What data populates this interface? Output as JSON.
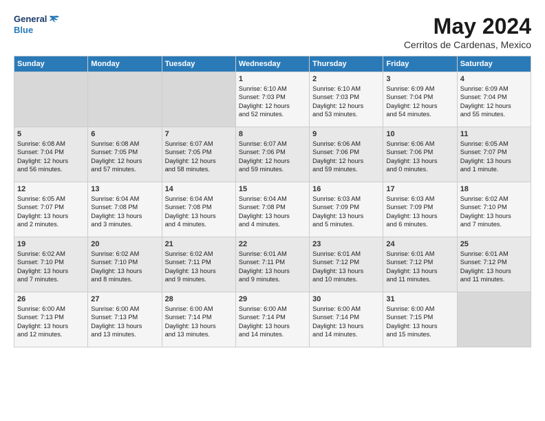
{
  "header": {
    "logo_line1": "General",
    "logo_line2": "Blue",
    "month_title": "May 2024",
    "location": "Cerritos de Cardenas, Mexico"
  },
  "days_of_week": [
    "Sunday",
    "Monday",
    "Tuesday",
    "Wednesday",
    "Thursday",
    "Friday",
    "Saturday"
  ],
  "weeks": [
    [
      {
        "day": "",
        "content": ""
      },
      {
        "day": "",
        "content": ""
      },
      {
        "day": "",
        "content": ""
      },
      {
        "day": "1",
        "content": "Sunrise: 6:10 AM\nSunset: 7:03 PM\nDaylight: 12 hours\nand 52 minutes."
      },
      {
        "day": "2",
        "content": "Sunrise: 6:10 AM\nSunset: 7:03 PM\nDaylight: 12 hours\nand 53 minutes."
      },
      {
        "day": "3",
        "content": "Sunrise: 6:09 AM\nSunset: 7:04 PM\nDaylight: 12 hours\nand 54 minutes."
      },
      {
        "day": "4",
        "content": "Sunrise: 6:09 AM\nSunset: 7:04 PM\nDaylight: 12 hours\nand 55 minutes."
      }
    ],
    [
      {
        "day": "5",
        "content": "Sunrise: 6:08 AM\nSunset: 7:04 PM\nDaylight: 12 hours\nand 56 minutes."
      },
      {
        "day": "6",
        "content": "Sunrise: 6:08 AM\nSunset: 7:05 PM\nDaylight: 12 hours\nand 57 minutes."
      },
      {
        "day": "7",
        "content": "Sunrise: 6:07 AM\nSunset: 7:05 PM\nDaylight: 12 hours\nand 58 minutes."
      },
      {
        "day": "8",
        "content": "Sunrise: 6:07 AM\nSunset: 7:06 PM\nDaylight: 12 hours\nand 59 minutes."
      },
      {
        "day": "9",
        "content": "Sunrise: 6:06 AM\nSunset: 7:06 PM\nDaylight: 12 hours\nand 59 minutes."
      },
      {
        "day": "10",
        "content": "Sunrise: 6:06 AM\nSunset: 7:06 PM\nDaylight: 13 hours\nand 0 minutes."
      },
      {
        "day": "11",
        "content": "Sunrise: 6:05 AM\nSunset: 7:07 PM\nDaylight: 13 hours\nand 1 minute."
      }
    ],
    [
      {
        "day": "12",
        "content": "Sunrise: 6:05 AM\nSunset: 7:07 PM\nDaylight: 13 hours\nand 2 minutes."
      },
      {
        "day": "13",
        "content": "Sunrise: 6:04 AM\nSunset: 7:08 PM\nDaylight: 13 hours\nand 3 minutes."
      },
      {
        "day": "14",
        "content": "Sunrise: 6:04 AM\nSunset: 7:08 PM\nDaylight: 13 hours\nand 4 minutes."
      },
      {
        "day": "15",
        "content": "Sunrise: 6:04 AM\nSunset: 7:08 PM\nDaylight: 13 hours\nand 4 minutes."
      },
      {
        "day": "16",
        "content": "Sunrise: 6:03 AM\nSunset: 7:09 PM\nDaylight: 13 hours\nand 5 minutes."
      },
      {
        "day": "17",
        "content": "Sunrise: 6:03 AM\nSunset: 7:09 PM\nDaylight: 13 hours\nand 6 minutes."
      },
      {
        "day": "18",
        "content": "Sunrise: 6:02 AM\nSunset: 7:10 PM\nDaylight: 13 hours\nand 7 minutes."
      }
    ],
    [
      {
        "day": "19",
        "content": "Sunrise: 6:02 AM\nSunset: 7:10 PM\nDaylight: 13 hours\nand 7 minutes."
      },
      {
        "day": "20",
        "content": "Sunrise: 6:02 AM\nSunset: 7:10 PM\nDaylight: 13 hours\nand 8 minutes."
      },
      {
        "day": "21",
        "content": "Sunrise: 6:02 AM\nSunset: 7:11 PM\nDaylight: 13 hours\nand 9 minutes."
      },
      {
        "day": "22",
        "content": "Sunrise: 6:01 AM\nSunset: 7:11 PM\nDaylight: 13 hours\nand 9 minutes."
      },
      {
        "day": "23",
        "content": "Sunrise: 6:01 AM\nSunset: 7:12 PM\nDaylight: 13 hours\nand 10 minutes."
      },
      {
        "day": "24",
        "content": "Sunrise: 6:01 AM\nSunset: 7:12 PM\nDaylight: 13 hours\nand 11 minutes."
      },
      {
        "day": "25",
        "content": "Sunrise: 6:01 AM\nSunset: 7:12 PM\nDaylight: 13 hours\nand 11 minutes."
      }
    ],
    [
      {
        "day": "26",
        "content": "Sunrise: 6:00 AM\nSunset: 7:13 PM\nDaylight: 13 hours\nand 12 minutes."
      },
      {
        "day": "27",
        "content": "Sunrise: 6:00 AM\nSunset: 7:13 PM\nDaylight: 13 hours\nand 13 minutes."
      },
      {
        "day": "28",
        "content": "Sunrise: 6:00 AM\nSunset: 7:14 PM\nDaylight: 13 hours\nand 13 minutes."
      },
      {
        "day": "29",
        "content": "Sunrise: 6:00 AM\nSunset: 7:14 PM\nDaylight: 13 hours\nand 14 minutes."
      },
      {
        "day": "30",
        "content": "Sunrise: 6:00 AM\nSunset: 7:14 PM\nDaylight: 13 hours\nand 14 minutes."
      },
      {
        "day": "31",
        "content": "Sunrise: 6:00 AM\nSunset: 7:15 PM\nDaylight: 13 hours\nand 15 minutes."
      },
      {
        "day": "",
        "content": ""
      }
    ]
  ]
}
